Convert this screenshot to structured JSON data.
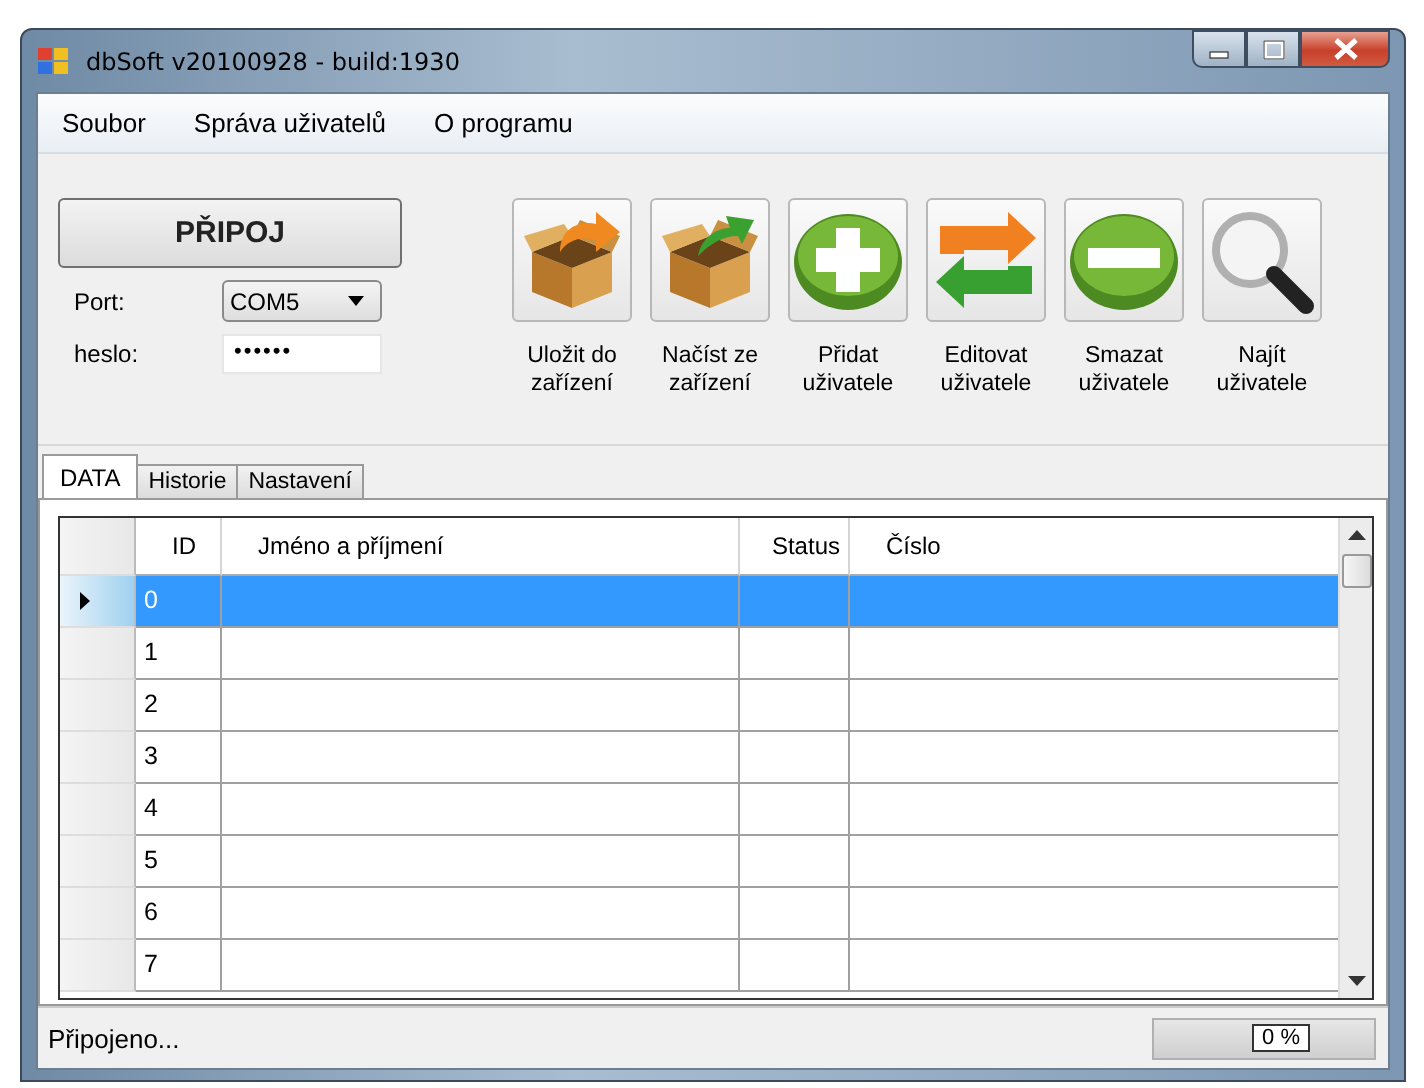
{
  "window": {
    "title": "dbSoft v20100928 - build:1930"
  },
  "menu": [
    "Soubor",
    "Správa uživatelů",
    "O programu"
  ],
  "connect_button": "PŘIPOJ",
  "port": {
    "label": "Port:",
    "value": "COM5"
  },
  "password": {
    "label": "heslo:",
    "value": "••••••"
  },
  "toolbar": [
    {
      "kind": "save",
      "lines": [
        "Uložit do",
        "zařízení"
      ]
    },
    {
      "kind": "load",
      "lines": [
        "Načíst ze",
        "zařízení"
      ]
    },
    {
      "kind": "add",
      "lines": [
        "Přidat",
        "uživatele"
      ]
    },
    {
      "kind": "edit",
      "lines": [
        "Editovat",
        "uživatele"
      ]
    },
    {
      "kind": "delete",
      "lines": [
        "Smazat",
        "uživatele"
      ]
    },
    {
      "kind": "find",
      "lines": [
        "Najít",
        "uživatele"
      ]
    }
  ],
  "tabs": [
    {
      "label": "DATA",
      "selected": true
    },
    {
      "label": "Historie",
      "selected": false
    },
    {
      "label": "Nastavení",
      "selected": false
    }
  ],
  "table": {
    "columns": [
      "ID",
      "Jméno a příjmení",
      "Status",
      "Číslo"
    ],
    "rows": [
      {
        "id": "0",
        "selected": true
      },
      {
        "id": "1",
        "selected": false
      },
      {
        "id": "2",
        "selected": false
      },
      {
        "id": "3",
        "selected": false
      },
      {
        "id": "4",
        "selected": false
      },
      {
        "id": "5",
        "selected": false
      },
      {
        "id": "6",
        "selected": false
      },
      {
        "id": "7",
        "selected": false
      }
    ]
  },
  "status_bar": {
    "text": "Připojeno...",
    "progress": {
      "level": 0,
      "text": "0 %"
    }
  }
}
